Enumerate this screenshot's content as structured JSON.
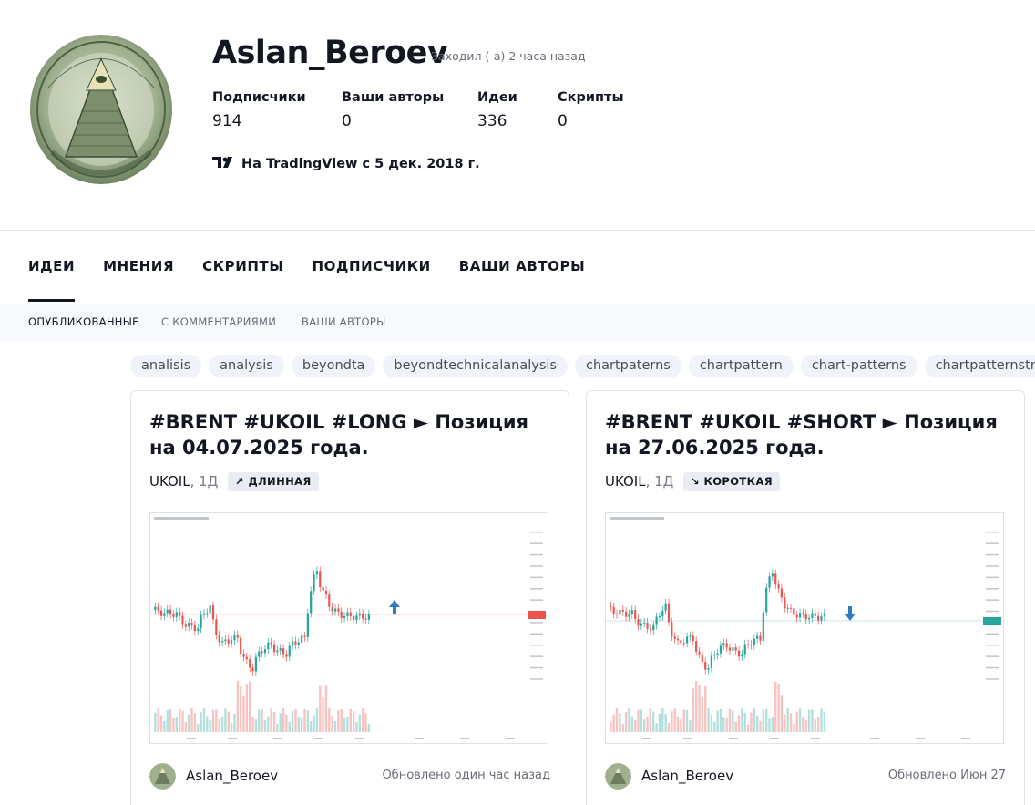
{
  "profile": {
    "username": "Aslan_Beroev",
    "last_seen": "Заходил (-а) 2 часа назад",
    "since": "На TradingView с 5 дек. 2018 г.",
    "stats": [
      {
        "label": "Подписчики",
        "value": "914"
      },
      {
        "label": "Ваши авторы",
        "value": "0"
      },
      {
        "label": "Идеи",
        "value": "336"
      },
      {
        "label": "Скрипты",
        "value": "0"
      }
    ]
  },
  "tabs": [
    "ИДЕИ",
    "МНЕНИЯ",
    "СКРИПТЫ",
    "ПОДПИСЧИКИ",
    "ВАШИ АВТОРЫ"
  ],
  "subtabs": [
    "ОПУБЛИКОВАННЫЕ",
    "С КОММЕНТАРИЯМИ",
    "ВАШИ АВТОРЫ"
  ],
  "tags": [
    "analisis",
    "analysis",
    "beyondta",
    "beyondtechnicalanalysis",
    "chartpaterns",
    "chartpattern",
    "chart-patterns",
    "chartpatternstrading"
  ],
  "cards": [
    {
      "title": "#BRENT #UKOIL #LONG ► Позиция на 04.07.2025 года.",
      "symbol": "UKOIL",
      "timeframe": ", 1Д",
      "badge_icon": "↗",
      "badge": "ДЛИННАЯ",
      "author": "Aslan_Beroev",
      "updated": "Обновлено один час назад"
    },
    {
      "title": "#BRENT #UKOIL #SHORT ► Позиция на 27.06.2025 года.",
      "symbol": "UKOIL",
      "timeframe": ", 1Д",
      "badge_icon": "↘",
      "badge": "КОРОТКАЯ",
      "author": "Aslan_Beroev",
      "updated": "Обновлено Июн 27"
    }
  ],
  "colors": {
    "up": "#26a69a",
    "down": "#ef5350",
    "arrow": "#2f7bbf"
  }
}
